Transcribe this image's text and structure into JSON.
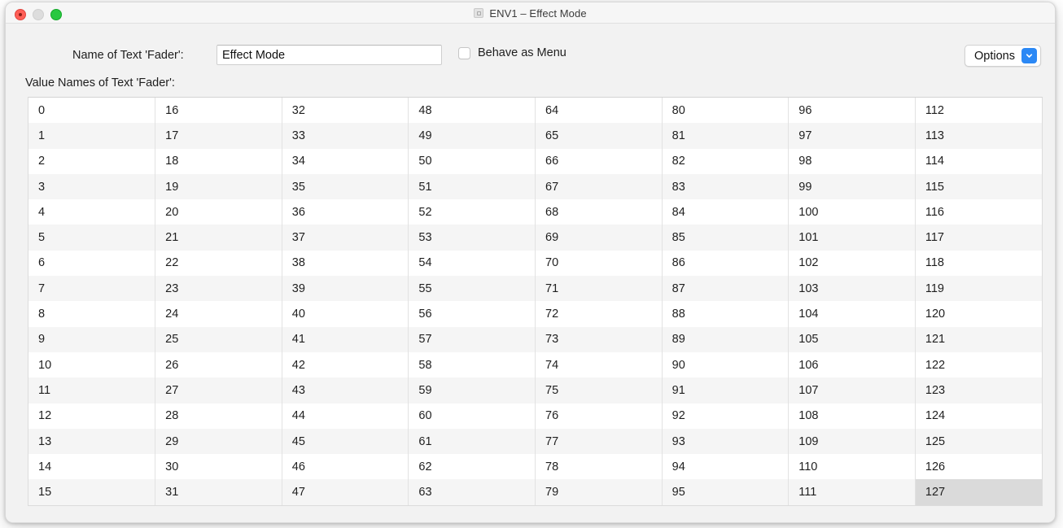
{
  "window": {
    "title": "ENV1 – Effect Mode",
    "title_icon": "document-icon",
    "traffic_lights": [
      "close",
      "minimize",
      "zoom"
    ]
  },
  "form": {
    "name_label": "Name of Text 'Fader':",
    "name_value": "Effect Mode",
    "name_placeholder": "",
    "checkbox_label": "Behave as Menu",
    "checkbox_checked": false,
    "options_label": "Options",
    "options_chevron_icon": "chevron-down-icon",
    "options_accent_color": "#2b88f5",
    "values_label": "Value Names of Text 'Fader':"
  },
  "table": {
    "columns": 8,
    "rows": 16,
    "selected_value": "127",
    "cells": [
      [
        "0",
        "16",
        "32",
        "48",
        "64",
        "80",
        "96",
        "112"
      ],
      [
        "1",
        "17",
        "33",
        "49",
        "65",
        "81",
        "97",
        "113"
      ],
      [
        "2",
        "18",
        "34",
        "50",
        "66",
        "82",
        "98",
        "114"
      ],
      [
        "3",
        "19",
        "35",
        "51",
        "67",
        "83",
        "99",
        "115"
      ],
      [
        "4",
        "20",
        "36",
        "52",
        "68",
        "84",
        "100",
        "116"
      ],
      [
        "5",
        "21",
        "37",
        "53",
        "69",
        "85",
        "101",
        "117"
      ],
      [
        "6",
        "22",
        "38",
        "54",
        "70",
        "86",
        "102",
        "118"
      ],
      [
        "7",
        "23",
        "39",
        "55",
        "71",
        "87",
        "103",
        "119"
      ],
      [
        "8",
        "24",
        "40",
        "56",
        "72",
        "88",
        "104",
        "120"
      ],
      [
        "9",
        "25",
        "41",
        "57",
        "73",
        "89",
        "105",
        "121"
      ],
      [
        "10",
        "26",
        "42",
        "58",
        "74",
        "90",
        "106",
        "122"
      ],
      [
        "11",
        "27",
        "43",
        "59",
        "75",
        "91",
        "107",
        "123"
      ],
      [
        "12",
        "28",
        "44",
        "60",
        "76",
        "92",
        "108",
        "124"
      ],
      [
        "13",
        "29",
        "45",
        "61",
        "77",
        "93",
        "109",
        "125"
      ],
      [
        "14",
        "30",
        "46",
        "62",
        "78",
        "94",
        "110",
        "126"
      ],
      [
        "15",
        "31",
        "47",
        "63",
        "79",
        "95",
        "111",
        "127"
      ]
    ]
  }
}
